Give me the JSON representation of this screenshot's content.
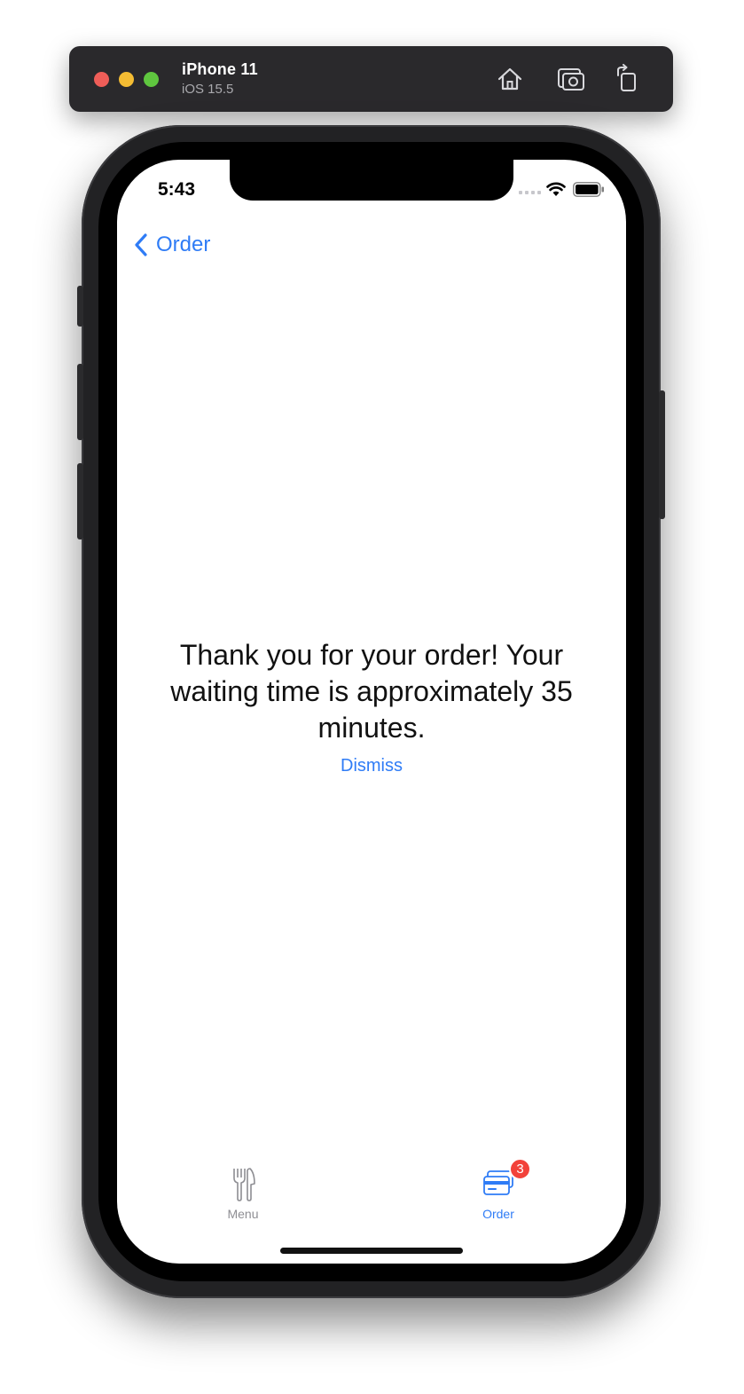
{
  "simulator": {
    "device_name": "iPhone 11",
    "os_version": "iOS 15.5",
    "buttons": [
      {
        "icon": "home-icon"
      },
      {
        "icon": "screenshot-icon"
      },
      {
        "icon": "rotate-icon"
      }
    ]
  },
  "status_bar": {
    "time": "5:43"
  },
  "nav": {
    "back_label": "Order",
    "back_icon": "chevron-left-icon"
  },
  "content": {
    "message": "Thank you for your order! Your waiting time is approximately 35 minutes.",
    "dismiss_label": "Dismiss"
  },
  "tab_bar": {
    "tabs": [
      {
        "label": "Menu",
        "icon": "fork-knife-icon",
        "selected": false
      },
      {
        "label": "Order",
        "icon": "credit-card-icon",
        "selected": true,
        "badge": "3"
      }
    ]
  },
  "colors": {
    "accent": "#2f7cf6",
    "badge": "#f2423a",
    "inactive": "#8e8e93"
  }
}
